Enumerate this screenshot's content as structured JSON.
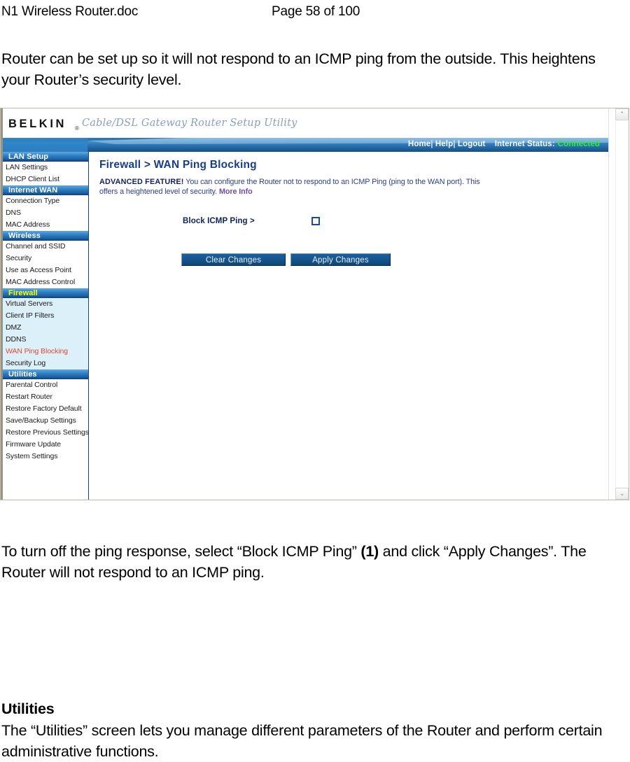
{
  "document": {
    "filename": "N1 Wireless Router.doc",
    "page_label": "Page 58 of 100",
    "intro_paragraph": "Router can be set up so it will not respond to an ICMP ping from the outside. This heightens your Router’s security level.",
    "instruction_pre": "To turn off the ping response, select “Block ICMP Ping” ",
    "instruction_bold": "(1)",
    "instruction_post": " and click “Apply Changes”. The Router will not respond to an ICMP ping.",
    "utilities_heading": "Utilities",
    "utilities_paragraph": "The “Utilities” screen lets you manage different parameters of the Router and perform certain administrative functions."
  },
  "router_ui": {
    "brand": {
      "logo": "BELKIN",
      "registered_mark": "®",
      "tagline": "Cable/DSL Gateway Router Setup Utility"
    },
    "topnav": {
      "home": "Home",
      "help": "Help",
      "logout": "Logout",
      "separator": "|",
      "internet_status_label": "Internet Status:",
      "internet_status_value": "Connected",
      "status_color": "#2bf52b"
    },
    "sidebar": {
      "sections": [
        {
          "title": "LAN Setup",
          "highlighted": false,
          "items": [
            {
              "label": "LAN Settings",
              "current": false
            },
            {
              "label": "DHCP Client List",
              "current": false
            }
          ]
        },
        {
          "title": "Internet WAN",
          "highlighted": false,
          "items": [
            {
              "label": "Connection Type",
              "current": false
            },
            {
              "label": "DNS",
              "current": false
            },
            {
              "label": "MAC Address",
              "current": false
            }
          ]
        },
        {
          "title": "Wireless",
          "highlighted": false,
          "items": [
            {
              "label": "Channel and SSID",
              "current": false
            },
            {
              "label": "Security",
              "current": false
            },
            {
              "label": "Use as Access Point",
              "current": false
            },
            {
              "label": "MAC Address Control",
              "current": false
            }
          ]
        },
        {
          "title": "Firewall",
          "highlighted": true,
          "items": [
            {
              "label": "Virtual Servers",
              "current": false
            },
            {
              "label": "Client IP Filters",
              "current": false
            },
            {
              "label": "DMZ",
              "current": false
            },
            {
              "label": "DDNS",
              "current": false
            },
            {
              "label": "WAN Ping Blocking",
              "current": true
            },
            {
              "label": "Security Log",
              "current": false
            }
          ]
        },
        {
          "title": "Utilities",
          "highlighted": false,
          "items": [
            {
              "label": "Parental Control",
              "current": false
            },
            {
              "label": "Restart Router",
              "current": false
            },
            {
              "label": "Restore Factory Default",
              "current": false
            },
            {
              "label": "Save/Backup Settings",
              "current": false
            },
            {
              "label": "Restore Previous Settings",
              "current": false
            },
            {
              "label": "Firmware Update",
              "current": false
            },
            {
              "label": "System Settings",
              "current": false
            }
          ]
        }
      ]
    },
    "panel": {
      "title": "Firewall > WAN Ping Blocking",
      "description_lead": "ADVANCED FEATURE!",
      "description_body": " You can configure the Router not to respond to an ICMP Ping (ping to the WAN port). This offers a heightened level of security. ",
      "description_link": "More Info",
      "field_label": "Block ICMP Ping >",
      "field_checked": false,
      "buttons": {
        "clear": "Clear Changes",
        "apply": "Apply Changes"
      }
    },
    "scrollbar": {
      "up_arrow": "⌃",
      "down_arrow": "⌄"
    }
  }
}
